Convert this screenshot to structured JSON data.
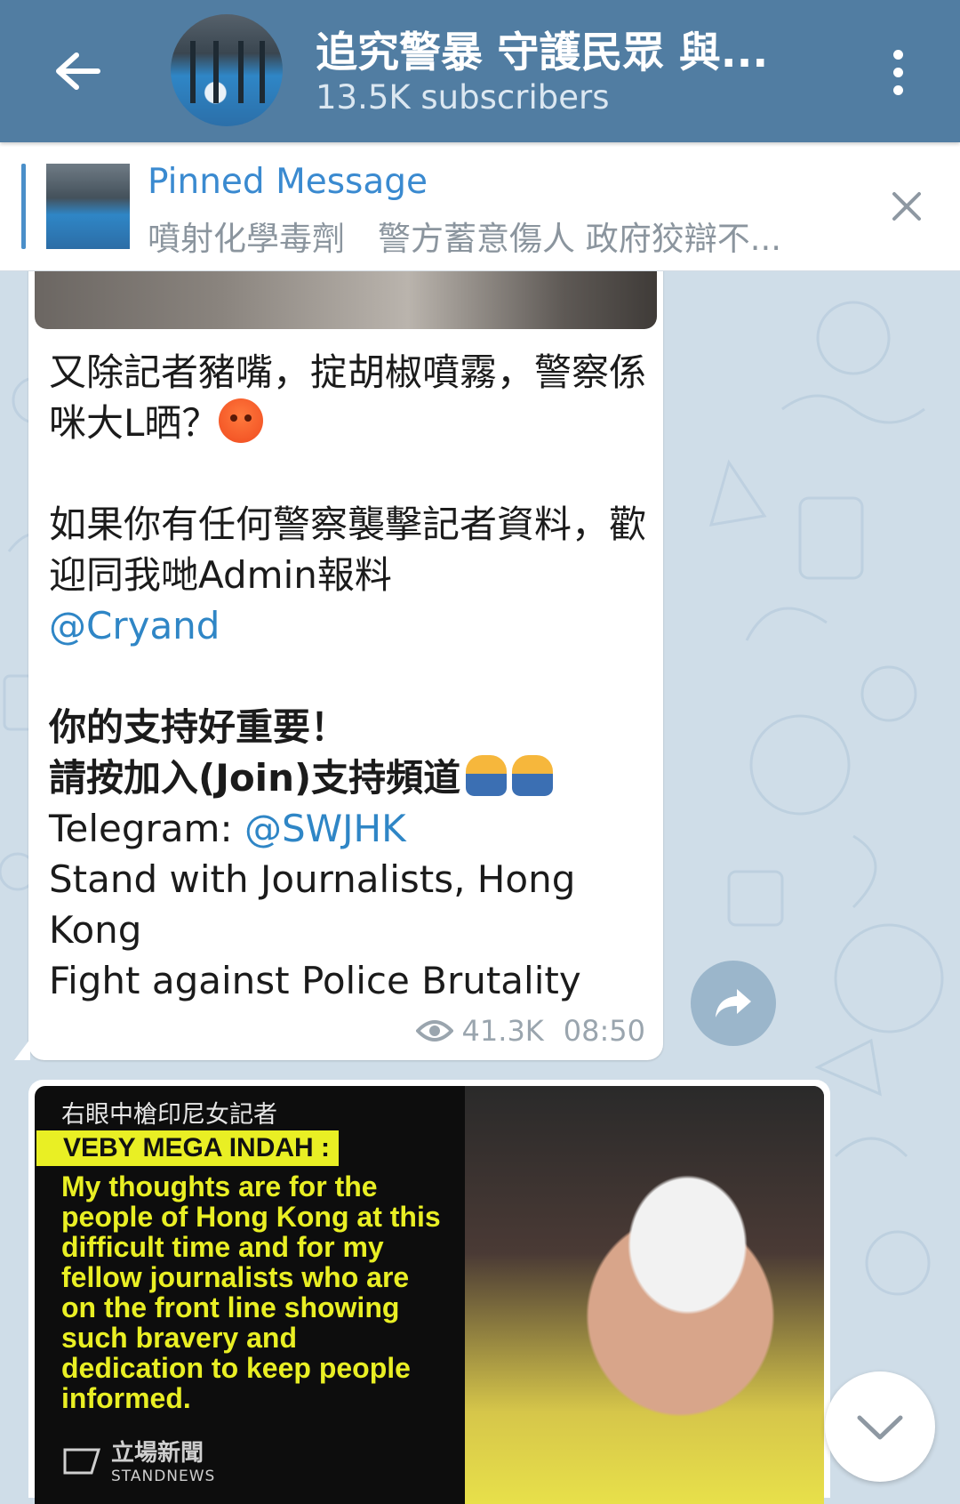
{
  "header": {
    "channel_title": "追究警暴 守護民眾 與...",
    "subscribers": "13.5K subscribers"
  },
  "pinned": {
    "title": "Pinned Message",
    "text": "噴射化學毒劑　警方蓄意傷人 政府狡辯不..."
  },
  "message": {
    "line1": "又除記者豬嘴，掟胡椒噴霧，警察係咪大L晒？",
    "line2": "如果你有任何警察襲擊記者資料，歡迎同我哋Admin報料",
    "mention_admin": "@Cryand",
    "bold1": "你的支持好重要！",
    "bold2": "請按加入(Join)支持頻道",
    "telegram_label": "Telegram: ",
    "telegram_handle": "@SWJHK",
    "stand_line": "Stand with Journalists, Hong Kong",
    "fight_line": "Fight against Police Brutality",
    "views": "41.3K",
    "time": "08:50"
  },
  "image_message": {
    "caption_cn": "右眼中槍印尼女記者",
    "name": "VEBY MEGA INDAH :",
    "quote": "My thoughts are for the people of Hong Kong at this difficult time and for my fellow journalists who are on the front line showing such bravery and dedication to keep people informed.",
    "logo_cn": "立場新聞",
    "logo_en": "STANDNEWS"
  },
  "colors": {
    "header_bg": "#517da2",
    "link": "#2f86c6",
    "chat_bg": "#cfdde8",
    "caption_yellow": "#e9ef24"
  },
  "icons": [
    "back-arrow-icon",
    "more-vertical-icon",
    "close-icon",
    "eye-icon",
    "share-icon",
    "chevron-down-icon"
  ]
}
